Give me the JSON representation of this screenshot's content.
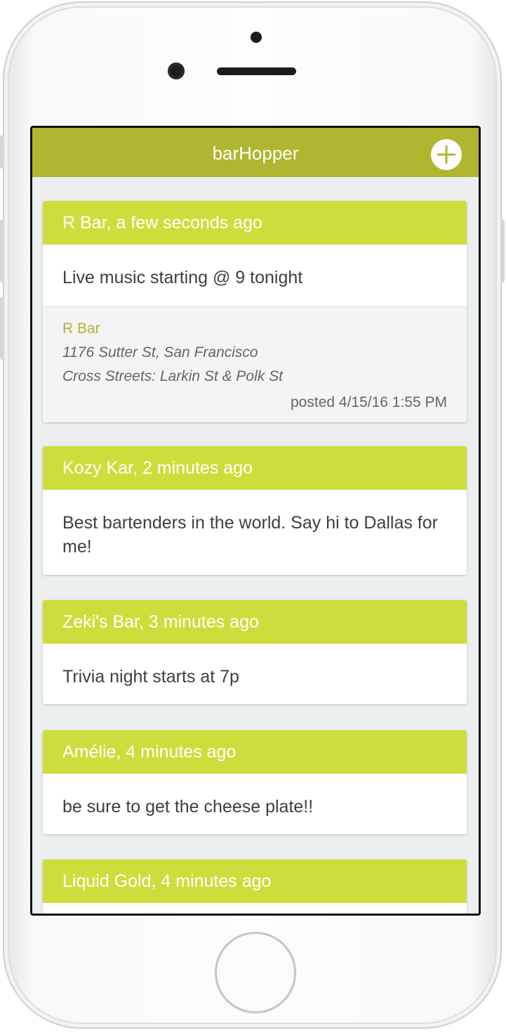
{
  "app": {
    "title": "barHopper"
  },
  "posts": [
    {
      "header": "R Bar, a few seconds ago",
      "message": "Live music starting @ 9 tonight",
      "venue": {
        "name": "R Bar",
        "address": "1176 Sutter St, San Francisco",
        "cross_streets": "Cross Streets: Larkin St & Polk St",
        "posted": "posted 4/15/16 1:55 PM"
      }
    },
    {
      "header": "Kozy Kar, 2 minutes ago",
      "message": "Best bartenders in the world. Say hi to Dallas for me!"
    },
    {
      "header": "Zeki's Bar, 3 minutes ago",
      "message": "Trivia night starts at 7p"
    },
    {
      "header": "Amélie, 4 minutes ago",
      "message": "be sure to get the cheese plate!!"
    },
    {
      "header": "Liquid Gold, 4 minutes ago",
      "message": ""
    }
  ],
  "icons": {
    "add": "plus-circle-icon"
  },
  "colors": {
    "appbar": "#b0b62f",
    "card_header": "#cfdd3c",
    "venue_name": "#b0b62f",
    "background": "#eceff0"
  }
}
